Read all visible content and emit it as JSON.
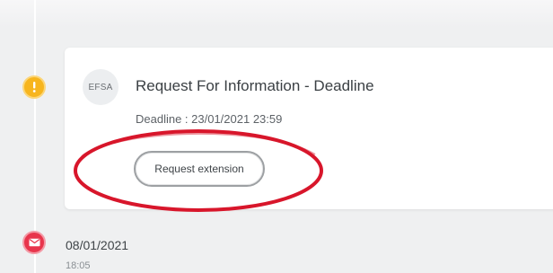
{
  "card": {
    "avatar_text": "EFSA",
    "title": "Request For Information - Deadline",
    "deadline": "Deadline : 23/01/2021 23:59",
    "button_label": "Request extension"
  },
  "event": {
    "date": "08/01/2021",
    "time": "18:05"
  },
  "icons": {
    "warning": "exclamation-icon",
    "email": "envelope-icon"
  },
  "colors": {
    "warning_marker": "#f7b51e",
    "email_marker": "#e8354c",
    "annotation_circle": "#d8162b",
    "card_background": "#ffffff",
    "page_background": "#eff0f1"
  }
}
